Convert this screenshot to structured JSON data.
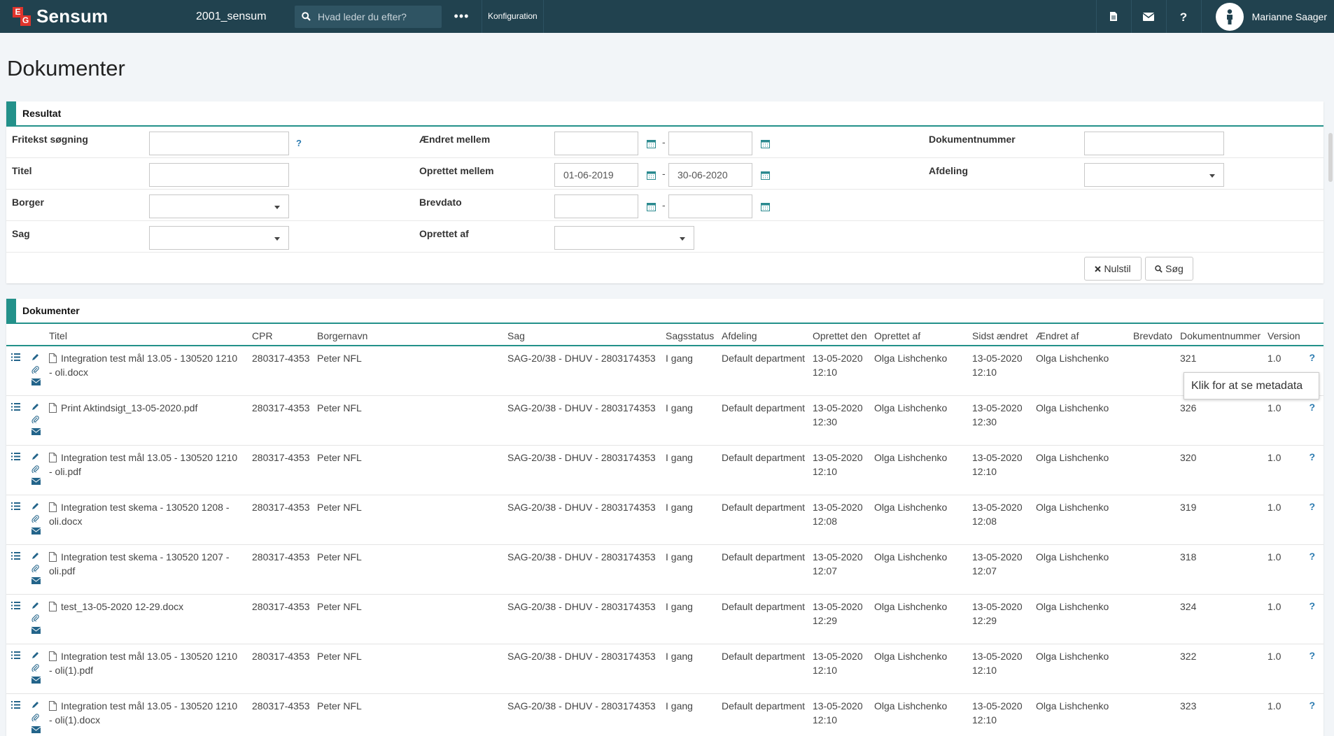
{
  "app": {
    "logo_e": "E",
    "logo_g": "G",
    "name": "Sensum",
    "tenant": "2001_sensum",
    "search_placeholder": "Hvad leder du efter?",
    "more": "•••",
    "config": "Konfiguration",
    "user_name": "Marianne Saager"
  },
  "page": {
    "title": "Dokumenter"
  },
  "filters": {
    "panel_title": "Resultat",
    "fritekst_label": "Fritekst søgning",
    "fritekst_help": "?",
    "titel_label": "Titel",
    "borger_label": "Borger",
    "sag_label": "Sag",
    "aendret_label": "Ændret mellem",
    "oprettet_label": "Oprettet mellem",
    "brevdato_label": "Brevdato",
    "oprettet_af_label": "Oprettet af",
    "dokumentnummer_label": "Dokumentnummer",
    "afdeling_label": "Afdeling",
    "range_sep": "-",
    "oprettet_from": "01-06-2019",
    "oprettet_to": "30-06-2020",
    "reset_label": "Nulstil",
    "search_label": "Søg"
  },
  "documents": {
    "panel_title": "Dokumenter",
    "columns": [
      "Titel",
      "CPR",
      "Borgernavn",
      "Sag",
      "Sagsstatus",
      "Afdeling",
      "Oprettet den",
      "Oprettet af",
      "Sidst ændret",
      "Ændret af",
      "Brevdato",
      "Dokumentnummer",
      "Version"
    ],
    "rows": [
      {
        "title1": "Integration test mål 13.05 - 130520 1210",
        "title2": "- oli.docx",
        "cpr": "280317-4353",
        "name": "Peter NFL",
        "sag": "SAG-20/38 - DHUV  - 2803174353",
        "status": "I gang",
        "afdeling": "Default department",
        "created_date": "13-05-2020",
        "created_time": "12:10",
        "created_by": "Olga Lishchenko",
        "changed_date": "13-05-2020",
        "changed_time": "12:10",
        "changed_by": "Olga Lishchenko",
        "brevdato": "",
        "docnr": "321",
        "version": "1.0",
        "help": "?"
      },
      {
        "title1": "Print Aktindsigt_13-05-2020.pdf",
        "title2": "",
        "cpr": "280317-4353",
        "name": "Peter NFL",
        "sag": "SAG-20/38 - DHUV  - 2803174353",
        "status": "I gang",
        "afdeling": "Default department",
        "created_date": "13-05-2020",
        "created_time": "12:30",
        "created_by": "Olga Lishchenko",
        "changed_date": "13-05-2020",
        "changed_time": "12:30",
        "changed_by": "Olga Lishchenko",
        "brevdato": "",
        "docnr": "326",
        "version": "1.0",
        "help": "?"
      },
      {
        "title1": "Integration test mål 13.05 - 130520 1210",
        "title2": "- oli.pdf",
        "cpr": "280317-4353",
        "name": "Peter NFL",
        "sag": "SAG-20/38 - DHUV  - 2803174353",
        "status": "I gang",
        "afdeling": "Default department",
        "created_date": "13-05-2020",
        "created_time": "12:10",
        "created_by": "Olga Lishchenko",
        "changed_date": "13-05-2020",
        "changed_time": "12:10",
        "changed_by": "Olga Lishchenko",
        "brevdato": "",
        "docnr": "320",
        "version": "1.0",
        "help": "?"
      },
      {
        "title1": "Integration test skema - 130520 1208 -",
        "title2": "oli.docx",
        "cpr": "280317-4353",
        "name": "Peter NFL",
        "sag": "SAG-20/38 - DHUV  - 2803174353",
        "status": "I gang",
        "afdeling": "Default department",
        "created_date": "13-05-2020",
        "created_time": "12:08",
        "created_by": "Olga Lishchenko",
        "changed_date": "13-05-2020",
        "changed_time": "12:08",
        "changed_by": "Olga Lishchenko",
        "brevdato": "",
        "docnr": "319",
        "version": "1.0",
        "help": "?"
      },
      {
        "title1": "Integration test skema - 130520 1207 -",
        "title2": "oli.pdf",
        "cpr": "280317-4353",
        "name": "Peter NFL",
        "sag": "SAG-20/38 - DHUV  - 2803174353",
        "status": "I gang",
        "afdeling": "Default department",
        "created_date": "13-05-2020",
        "created_time": "12:07",
        "created_by": "Olga Lishchenko",
        "changed_date": "13-05-2020",
        "changed_time": "12:07",
        "changed_by": "Olga Lishchenko",
        "brevdato": "",
        "docnr": "318",
        "version": "1.0",
        "help": "?"
      },
      {
        "title1": "test_13-05-2020 12-29.docx",
        "title2": "",
        "cpr": "280317-4353",
        "name": "Peter NFL",
        "sag": "SAG-20/38 - DHUV  - 2803174353",
        "status": "I gang",
        "afdeling": "Default department",
        "created_date": "13-05-2020",
        "created_time": "12:29",
        "created_by": "Olga Lishchenko",
        "changed_date": "13-05-2020",
        "changed_time": "12:29",
        "changed_by": "Olga Lishchenko",
        "brevdato": "",
        "docnr": "324",
        "version": "1.0",
        "help": "?"
      },
      {
        "title1": "Integration test mål 13.05 - 130520 1210",
        "title2": "- oli(1).pdf",
        "cpr": "280317-4353",
        "name": "Peter NFL",
        "sag": "SAG-20/38 - DHUV  - 2803174353",
        "status": "I gang",
        "afdeling": "Default department",
        "created_date": "13-05-2020",
        "created_time": "12:10",
        "created_by": "Olga Lishchenko",
        "changed_date": "13-05-2020",
        "changed_time": "12:10",
        "changed_by": "Olga Lishchenko",
        "brevdato": "",
        "docnr": "322",
        "version": "1.0",
        "help": "?"
      },
      {
        "title1": "Integration test mål 13.05 - 130520 1210",
        "title2": "- oli(1).docx",
        "cpr": "280317-4353",
        "name": "Peter NFL",
        "sag": "SAG-20/38 - DHUV  - 2803174353",
        "status": "I gang",
        "afdeling": "Default department",
        "created_date": "13-05-2020",
        "created_time": "12:10",
        "created_by": "Olga Lishchenko",
        "changed_date": "13-05-2020",
        "changed_time": "12:10",
        "changed_by": "Olga Lishchenko",
        "brevdato": "",
        "docnr": "323",
        "version": "1.0",
        "help": "?"
      }
    ]
  },
  "tooltip": {
    "text": "Klik for at se metadata"
  },
  "icons": {
    "search": "search-icon",
    "document": "document-icon",
    "mail": "mail-icon",
    "help": "help-icon",
    "user": "user-icon",
    "calendar": "calendar-icon",
    "list": "list-icon",
    "edit": "pencil-icon",
    "attach": "paperclip-icon",
    "envelope": "envelope-icon",
    "file": "file-icon",
    "close": "close-icon"
  },
  "colors": {
    "topbar": "#21424f",
    "accent": "#23918a",
    "link": "#2a7ab0",
    "logo_red": "#e0342c"
  }
}
